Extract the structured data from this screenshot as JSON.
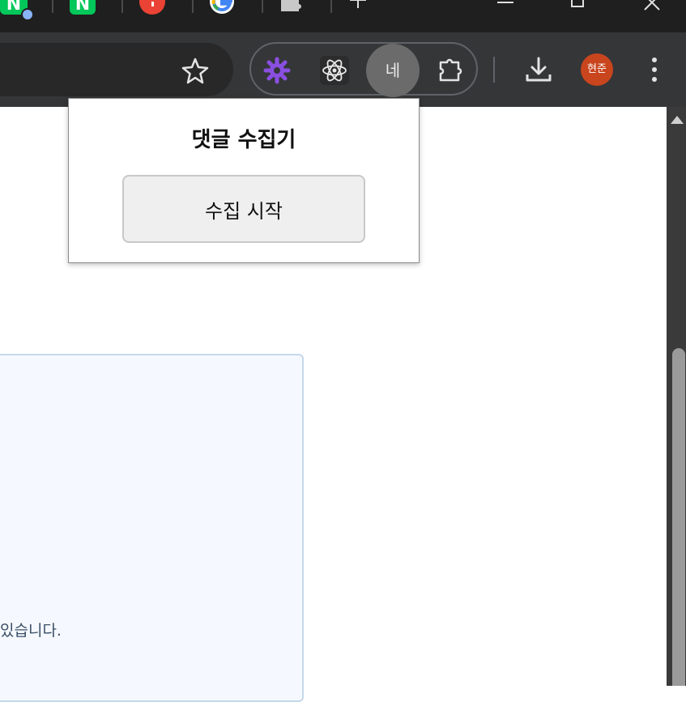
{
  "tabs": {
    "naver_letter": "N",
    "naver2_letter": "N"
  },
  "toolbar": {
    "active_extension_label": "네",
    "profile_name": "현준"
  },
  "page": {
    "info_text": "있습니다."
  },
  "popup": {
    "title": "댓글 수집기",
    "start_button": "수집 시작"
  },
  "colors": {
    "tabstrip_bg": "#1f1f1f",
    "toolbar_bg": "#353638",
    "avatar_bg": "#c9451e",
    "accent_purple": "#8a4fe0"
  }
}
